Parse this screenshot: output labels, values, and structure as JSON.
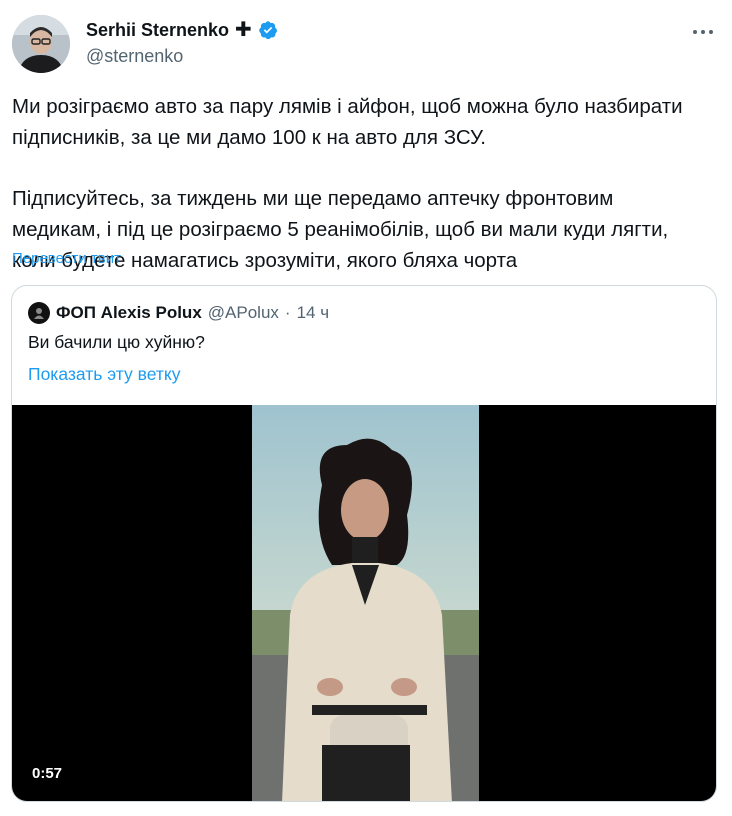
{
  "author": {
    "name": "Serhii Sternenko",
    "name_symbol": "✚",
    "handle": "@sternenko",
    "verified_color": "#1d9bf0"
  },
  "tweet": {
    "text": "Ми розіграємо авто за пару лямів і айфон, щоб можна було назбирати\nпідписників, за це ми дамо 100 к на авто для ЗСУ.\n\nПідписуйтесь, за тиждень ми ще передамо аптечку фронтовим\nмедикам, і під це розіграємо 5 реанімобілів, щоб ви мали куди лягти,\nколи будете намагатись зрозуміти, якого бляха чорта",
    "translate_link": "Перевести твит"
  },
  "quoted": {
    "name": "ФОП Alexis Polux",
    "handle": "@APolux",
    "separator": "·",
    "time": "14 ч",
    "text": "Ви бачили цю хуйню?",
    "show_thread": "Показать эту ветку",
    "video": {
      "duration": "0:57"
    }
  },
  "colors": {
    "accent": "#1d9bf0",
    "secondary_text": "#536471",
    "border": "#cfd9de"
  }
}
